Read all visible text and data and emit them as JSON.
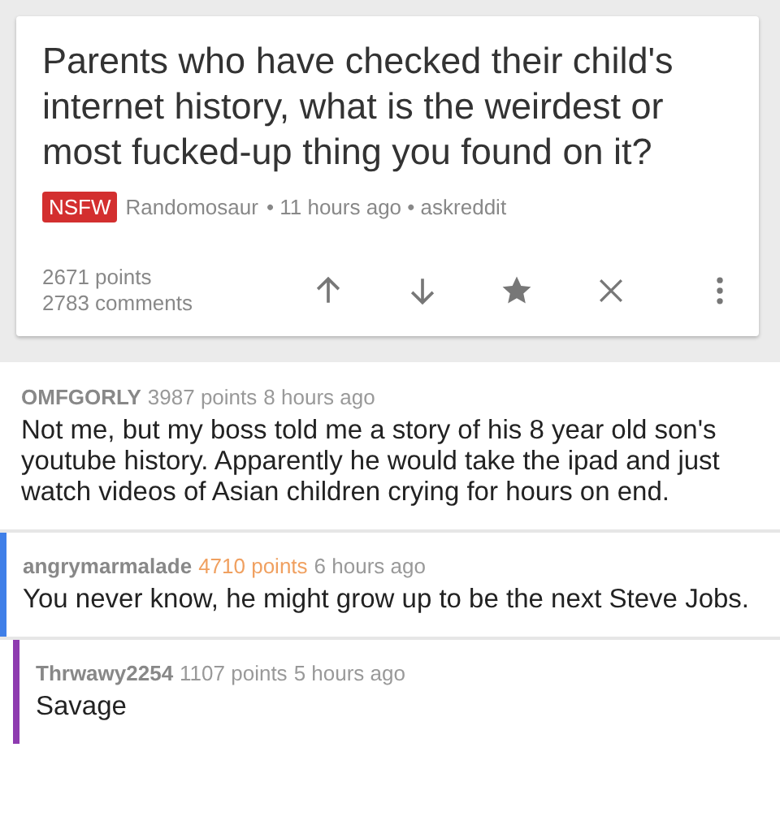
{
  "post": {
    "title": "Parents who have checked their child's internet history, what is the weirdest or most fucked-up thing you found on it?",
    "nsfw": true,
    "badge": "NSFW",
    "author": "Randomosaur",
    "meta": "• 11 hours ago • askreddit",
    "points": "2671 points",
    "comments": "2783 comments"
  },
  "comments": [
    {
      "author": "OMFGORLY",
      "points": "3987 points",
      "upvoted": false,
      "time": "8 hours ago",
      "text": "Not me, but my boss told me a story of his 8 year old son's youtube history. Apparently he would take the ipad and just watch videos of Asian children crying for hours on end.",
      "children": [
        {
          "author": "angrymarmalade",
          "points": "4710 points",
          "upvoted": true,
          "time": "6 hours ago",
          "color": "#3f7fe8",
          "text": "You never know, he might grow up to be the next Steve Jobs.",
          "children": [
            {
              "author": "Thrwawy2254",
              "points": "1107 points",
              "upvoted": false,
              "time": "5 hours ago",
              "color": "#8e3bb0",
              "text": "Savage"
            }
          ]
        }
      ]
    }
  ]
}
